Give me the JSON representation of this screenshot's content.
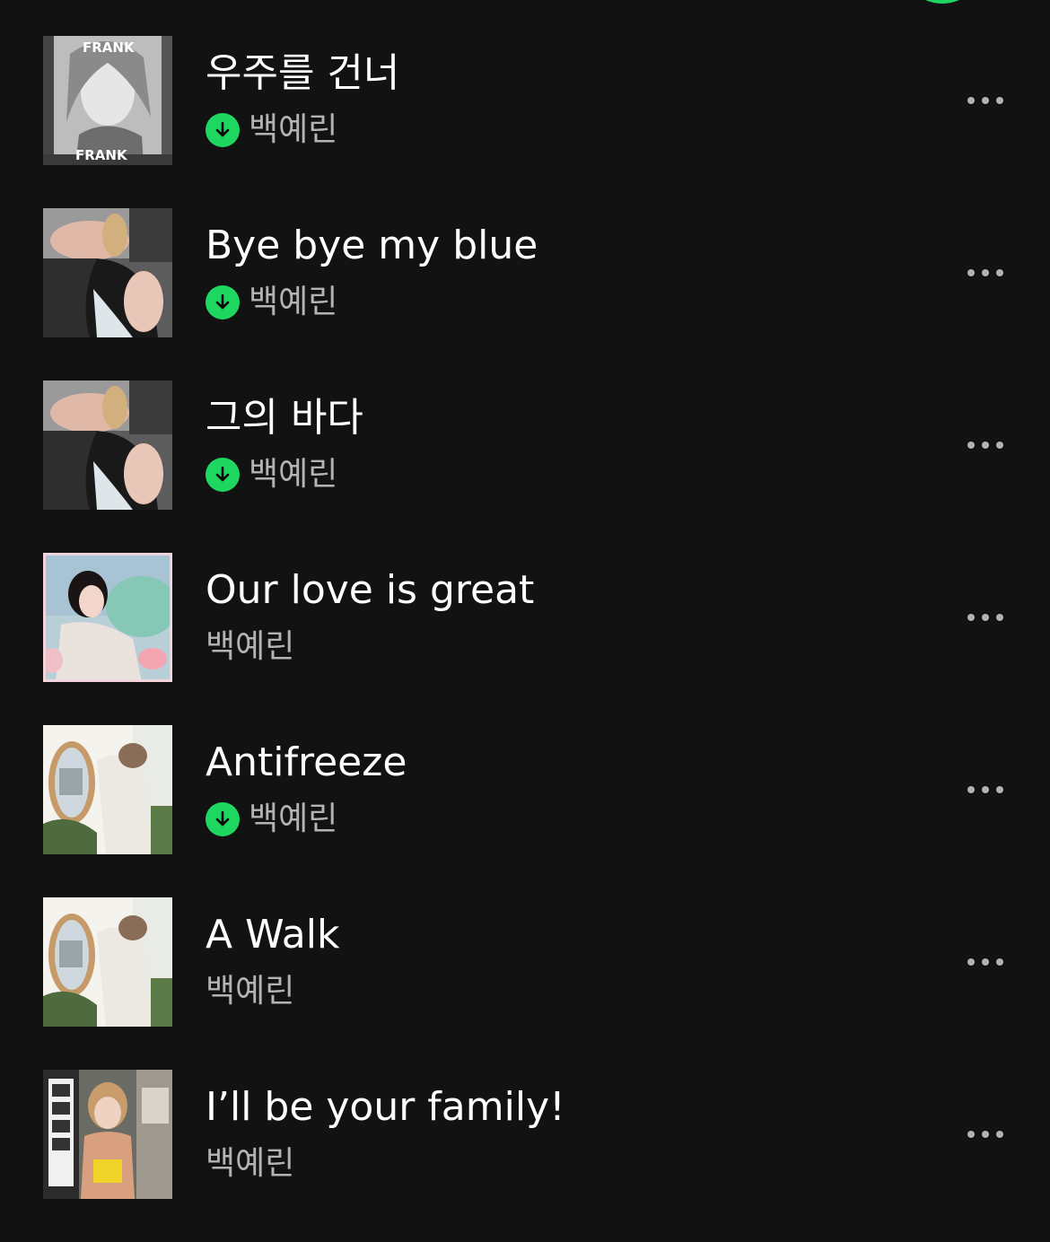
{
  "accent_color": "#1ed760",
  "tracks": [
    {
      "title": "우주를 건너",
      "artist": "백예린",
      "downloaded": true,
      "cover_icon": "album-cover-frank"
    },
    {
      "title": "Bye bye my blue",
      "artist": "백예린",
      "downloaded": true,
      "cover_icon": "album-cover-bye-bye-my-blue"
    },
    {
      "title": "그의 바다",
      "artist": "백예린",
      "downloaded": true,
      "cover_icon": "album-cover-bye-bye-my-blue"
    },
    {
      "title": "Our love is great",
      "artist": "백예린",
      "downloaded": false,
      "cover_icon": "album-cover-our-love-is-great"
    },
    {
      "title": "Antifreeze",
      "artist": "백예린",
      "downloaded": true,
      "cover_icon": "album-cover-mirror"
    },
    {
      "title": "A Walk",
      "artist": "백예린",
      "downloaded": false,
      "cover_icon": "album-cover-mirror"
    },
    {
      "title": "I’ll be your family!",
      "artist": "백예린",
      "downloaded": false,
      "cover_icon": "album-cover-family"
    }
  ]
}
